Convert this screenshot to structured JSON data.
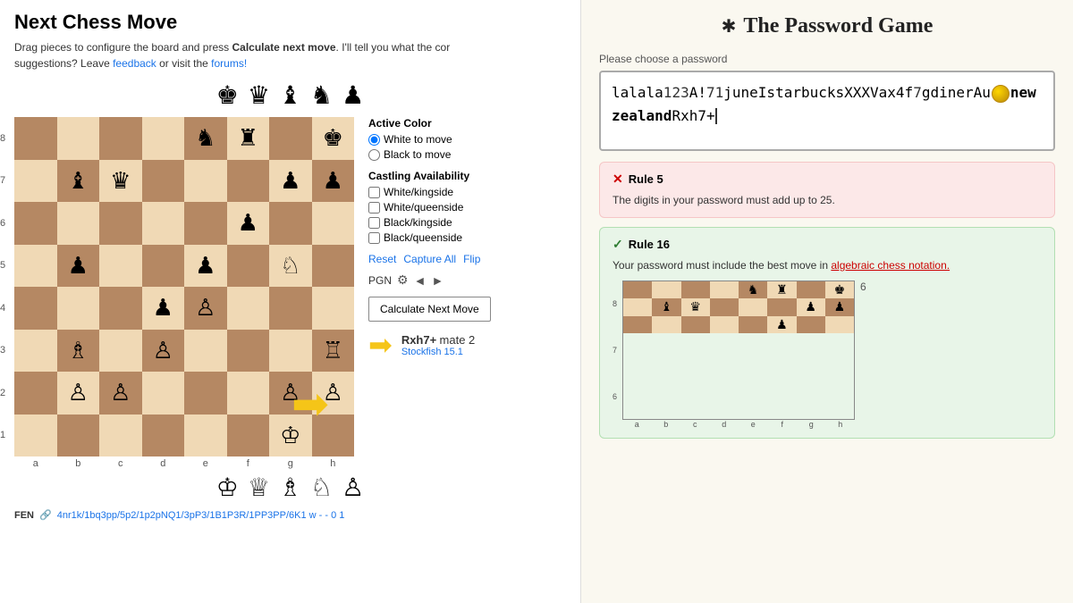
{
  "left": {
    "title": "Next Chess Move",
    "subtitle_start": "Drag pieces to configure the board and press ",
    "subtitle_bold": "Calculate next move",
    "subtitle_end": ". I'll tell you what the cor",
    "subtitle_feedback": "feedback",
    "subtitle_forums": "forums!",
    "pieces_top": [
      "♚",
      "♛",
      "♝",
      "♞",
      "♟"
    ],
    "pieces_bottom": [
      "♔",
      "♕",
      "♗",
      "♘",
      "♙"
    ],
    "active_color_title": "Active Color",
    "radio_white": "White to move",
    "radio_black": "Black to move",
    "white_selected": true,
    "castling_title": "Castling Availability",
    "castling_options": [
      "White/kingside",
      "White/queenside",
      "Black/kingside",
      "Black/queenside"
    ],
    "action_reset": "Reset",
    "action_capture_all": "Capture All",
    "action_flip": "Flip",
    "pgn_label": "PGN",
    "calc_button": "Calculate Next Move",
    "best_move": "Rxh7+",
    "mate": "mate 2",
    "engine": "Stockfish 15.1",
    "fen_label": "FEN",
    "fen_value": "4nr1k/1bq3pp/5p2/1p2pNQ1/3pP3/1B1P3R/1PP3PP/6K1 w - - 0 1",
    "rank_labels": [
      "8",
      "7",
      "6",
      "5",
      "4",
      "3",
      "2",
      "1"
    ],
    "file_labels": [
      "a",
      "b",
      "c",
      "d",
      "e",
      "f",
      "g",
      "h"
    ]
  },
  "right": {
    "app_title": "The Password Game",
    "password_label": "Please choose a password",
    "password_value": "lalala123A!71juneIstarbucksXXXVax4f7gdinerAu●newzealandRxh7+",
    "password_display_parts": [
      {
        "text": "lalala",
        "bold": false
      },
      {
        "text": "1",
        "bold": false
      },
      {
        "text": "2",
        "bold": false
      },
      {
        "text": "3",
        "bold": false
      },
      {
        "text": "A!7",
        "bold": false
      },
      {
        "text": "1",
        "bold": false
      },
      {
        "text": "juneIstarbucksXXXVax4f7gdinerAu",
        "bold": false
      },
      {
        "text": "[coin]",
        "bold": false
      },
      {
        "text": "newzealand",
        "bold": true
      },
      {
        "text": "Rxh7+",
        "bold": false
      }
    ],
    "rule5": {
      "number": "Rule 5",
      "status": "fail",
      "text": "The digits in your password must add up to 25."
    },
    "rule16": {
      "number": "Rule 16",
      "status": "pass",
      "text_before": "Your password must include the best move in ",
      "link_text": "algebraic chess notation.",
      "text_after": ""
    },
    "mini_board": {
      "rank_labels": [
        "8",
        "7",
        "6"
      ],
      "file_labels": [
        "a",
        "b",
        "c",
        "d",
        "e",
        "f",
        "g",
        "h"
      ]
    }
  }
}
